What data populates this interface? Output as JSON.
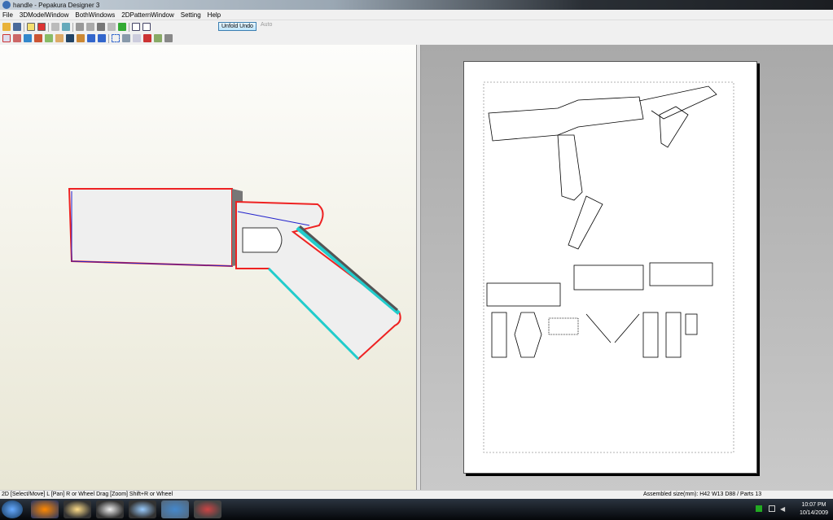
{
  "window": {
    "title": "handle - Pepakura Designer 3"
  },
  "menu": [
    "File",
    "3DModelWindow",
    "BothWindows",
    "2DPatternWindow",
    "Setting",
    "Help"
  ],
  "toolbar": {
    "unfold_undo": "Unfold Undo",
    "auto": "Auto"
  },
  "status": {
    "left": "2D [Select/Move] L [Pan] R or Wheel Drag [Zoom] Shift+R or Wheel",
    "right": "Assembled size(mm): H42 W13 D88 / Parts 13"
  },
  "taskbar": {
    "time": "10:07 PM",
    "date": "10/14/2009"
  }
}
